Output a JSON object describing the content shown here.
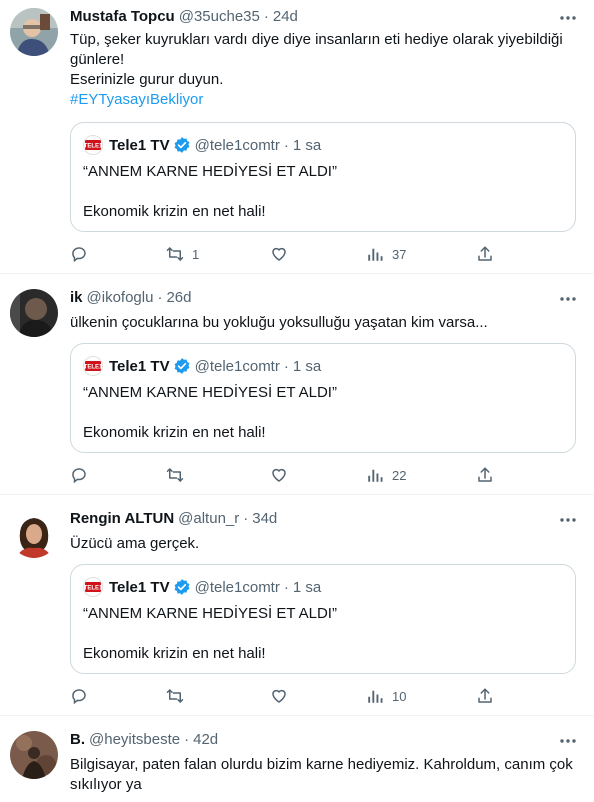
{
  "tweets": [
    {
      "name": "Mustafa Topcu",
      "handle": "@35uche35",
      "time": "24d",
      "lines": [
        "Tüp, şeker kuyrukları vardı diye diye insanların eti hediye olarak yiyebildiği",
        "günlere!",
        "Eserinizle gurur duyun."
      ],
      "hashtag": "#EYTyasayıBekliyor",
      "quote": {
        "name": "Tele1 TV",
        "handle": "@tele1comtr",
        "time": "1 sa",
        "title": "“ANNEM KARNE HEDİYESİ ET ALDI”",
        "body": "Ekonomik krizin en net hali!"
      },
      "retweets": "1",
      "views": "37"
    },
    {
      "name": "ik",
      "handle": "@ikofoglu",
      "time": "26d",
      "lines": [
        "ülkenin çocuklarına bu yokluğu yoksulluğu yaşatan kim varsa..."
      ],
      "quote": {
        "name": "Tele1 TV",
        "handle": "@tele1comtr",
        "time": "1 sa",
        "title": "“ANNEM KARNE HEDİYESİ ET ALDI”",
        "body": "Ekonomik krizin en net hali!"
      },
      "retweets": "",
      "views": "22"
    },
    {
      "name": "Rengin ALTUN",
      "handle": "@altun_r",
      "time": "34d",
      "lines": [
        "Üzücü ama gerçek."
      ],
      "quote": {
        "name": "Tele1 TV",
        "handle": "@tele1comtr",
        "time": "1 sa",
        "title": "“ANNEM KARNE HEDİYESİ ET ALDI”",
        "body": "Ekonomik krizin en net hali!"
      },
      "retweets": "",
      "views": "10"
    },
    {
      "name": "B.",
      "handle": "@heyitsbeste",
      "time": "42d",
      "lines": [
        "Bilgisayar, paten falan olurdu bizim karne hediyemiz. Kahroldum, canım çok",
        "sıkılıyor ya"
      ]
    }
  ],
  "colors": {
    "accent": "#1d9bf0",
    "secondary_text": "#536471",
    "border": "#cfd9de",
    "verified": "#1d9bf0"
  },
  "icons": {
    "more": "more-dots-icon",
    "reply": "reply-icon",
    "retweet": "retweet-icon",
    "like": "like-icon",
    "views": "views-icon",
    "share": "share-icon",
    "verified": "verified-badge-icon",
    "logo": "tele1-logo"
  }
}
